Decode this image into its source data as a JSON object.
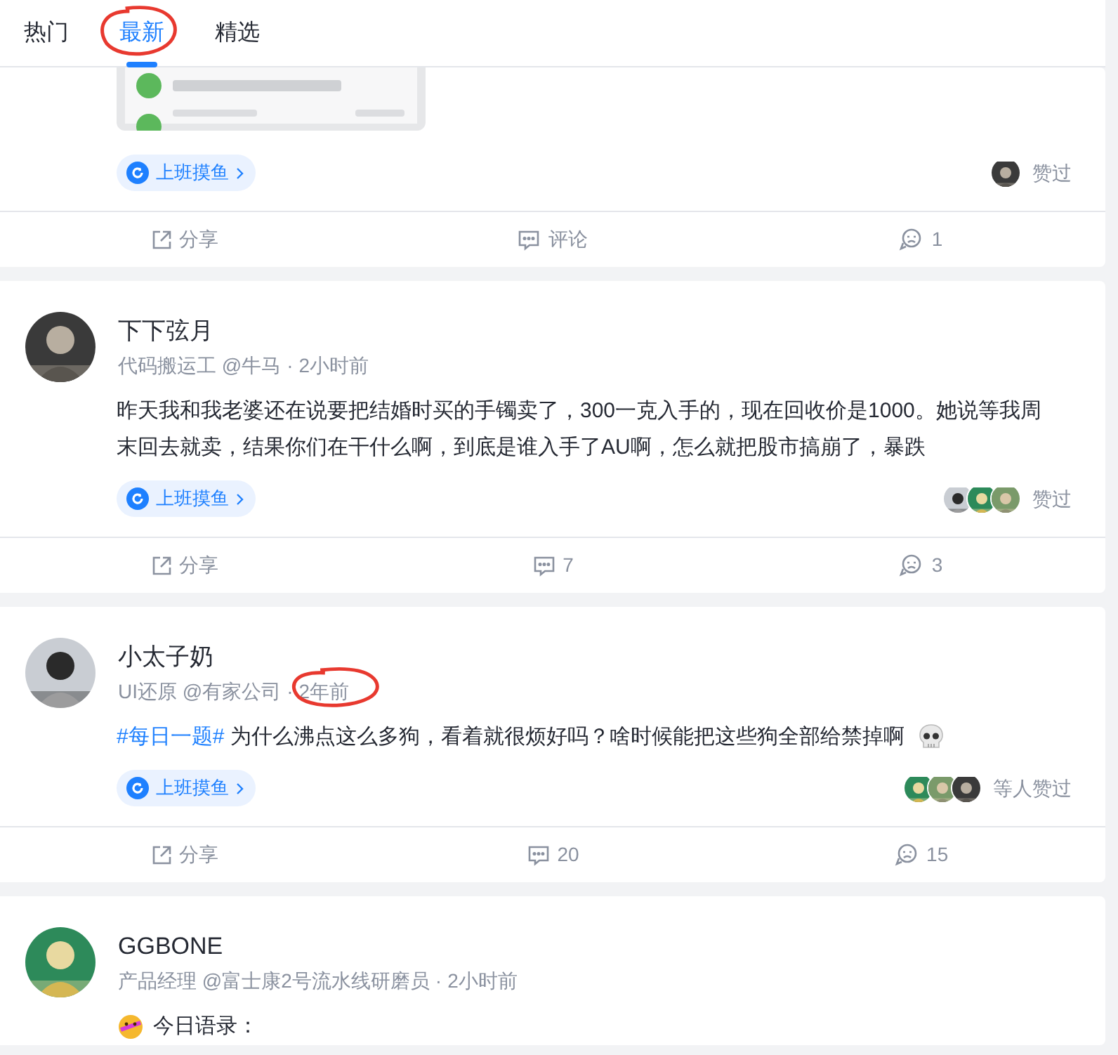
{
  "tabs": [
    {
      "label": "热门",
      "selected": false,
      "circled": false
    },
    {
      "label": "最新",
      "selected": true,
      "circled": true
    },
    {
      "label": "精选",
      "selected": false,
      "circled": false
    }
  ],
  "posts": [
    {
      "image": {
        "kind": "picture"
      },
      "tag": "上班摸鱼",
      "likers": [
        {
          "kind": "picture"
        }
      ],
      "like_text": "赞过",
      "actions": [
        {
          "kind": "share",
          "label": "分享"
        },
        {
          "kind": "comment",
          "label": "评论"
        },
        {
          "kind": "like",
          "label": "1"
        }
      ]
    },
    {
      "author": {
        "name": "下下弦月",
        "title": "代码搬运工 @牛马",
        "separator": "·",
        "time": "2小时前",
        "time_circled": false
      },
      "content": {
        "text": "昨天我和我老婆还在说要把结婚时买的手镯卖了，300一克入手的，现在回收价是1000。她说等我周末回去就卖，结果你们在干什么啊，到底是谁入手了AU啊，怎么就把股市搞崩了，暴跌"
      },
      "tag": "上班摸鱼",
      "likers": [
        {
          "kind": "picture"
        },
        {
          "kind": "picture"
        },
        {
          "kind": "picture"
        }
      ],
      "like_text": "赞过",
      "actions": [
        {
          "kind": "share",
          "label": "分享"
        },
        {
          "kind": "comment",
          "label": "7"
        },
        {
          "kind": "like",
          "label": "3"
        }
      ]
    },
    {
      "author": {
        "name": "小太子奶",
        "title": "UI还原 @有家公司",
        "separator": "·",
        "time": "2年前",
        "time_circled": true
      },
      "content": {
        "topic": "#每日一题#",
        "text": "为什么沸点这么多狗，看着就很烦好吗？啥时候能把这些狗全部给禁掉啊",
        "trailing_emoji": true
      },
      "tag": "上班摸鱼",
      "likers": [
        {
          "kind": "picture"
        },
        {
          "kind": "picture"
        },
        {
          "kind": "picture"
        }
      ],
      "like_text": "等人赞过",
      "actions": [
        {
          "kind": "share",
          "label": "分享"
        },
        {
          "kind": "comment",
          "label": "20"
        },
        {
          "kind": "like",
          "label": "15"
        }
      ]
    },
    {
      "author": {
        "name": "GGBONE",
        "title": "产品经理 @富士康2号流水线研磨员",
        "separator": "·",
        "time": "2小时前",
        "time_circled": false
      },
      "content": {
        "leading_emoji": true,
        "text": "今日语录："
      }
    }
  ]
}
